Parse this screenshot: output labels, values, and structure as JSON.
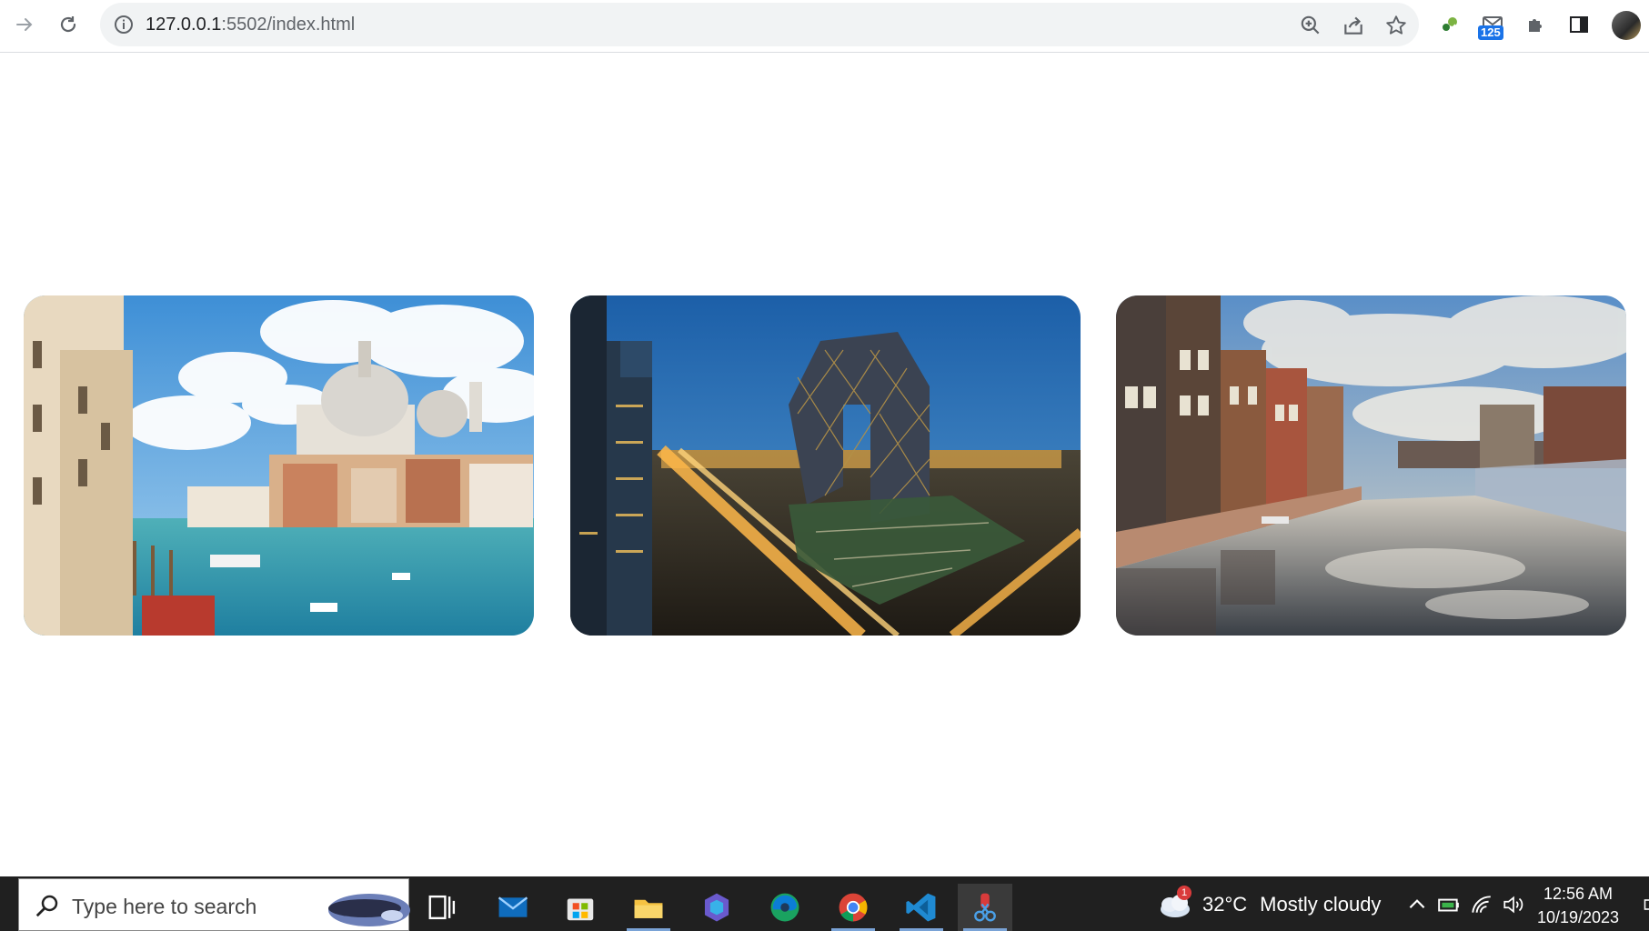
{
  "browser": {
    "url_host": "127.0.0.1",
    "url_rest": ":5502/index.html",
    "extension_badge": "125"
  },
  "gallery": {
    "images": [
      {
        "alt": "Venice Grand Canal"
      },
      {
        "alt": "Beijing CCTV tower at night"
      },
      {
        "alt": "Amsterdam canal reflection"
      }
    ]
  },
  "taskbar": {
    "search_placeholder": "Type here to search",
    "weather_badge": "1",
    "weather_temp": "32°C",
    "weather_desc": "Mostly cloudy",
    "time": "12:56 AM",
    "date": "10/19/2023"
  },
  "colors": {
    "accent": "#1a73e8",
    "taskbar_bg": "#202020",
    "omnibox_bg": "#f1f3f4"
  }
}
